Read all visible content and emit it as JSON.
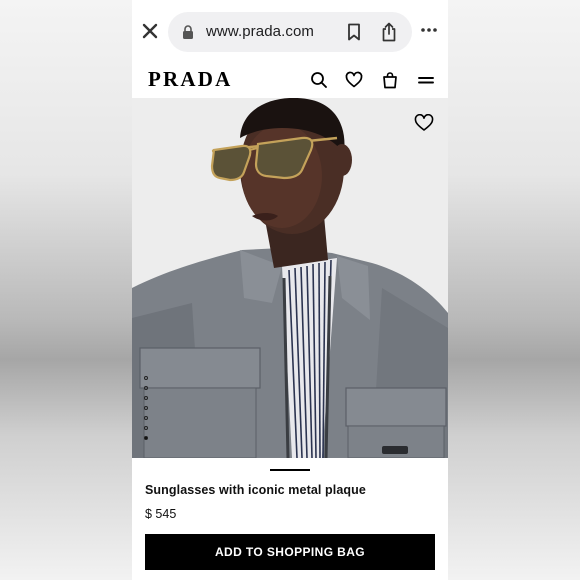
{
  "browser": {
    "url": "www.prada.com",
    "icons": [
      "close-icon",
      "lock-icon",
      "bookmark-icon",
      "share-icon",
      "more-icon"
    ]
  },
  "site": {
    "logo": "PRADA",
    "nav_icons": [
      "search-icon",
      "heart-icon",
      "shopping-bag-icon",
      "menu-icon"
    ]
  },
  "product": {
    "name": "Sunglasses with iconic metal plaque",
    "price": "$ 545",
    "cta": "ADD TO SHOPPING BAG",
    "gallery": {
      "image_count": 7,
      "active_index": 6
    }
  },
  "colors": {
    "brand": "#000000",
    "button_text": "#ffffff",
    "url_pill": "#f0f0f2"
  }
}
